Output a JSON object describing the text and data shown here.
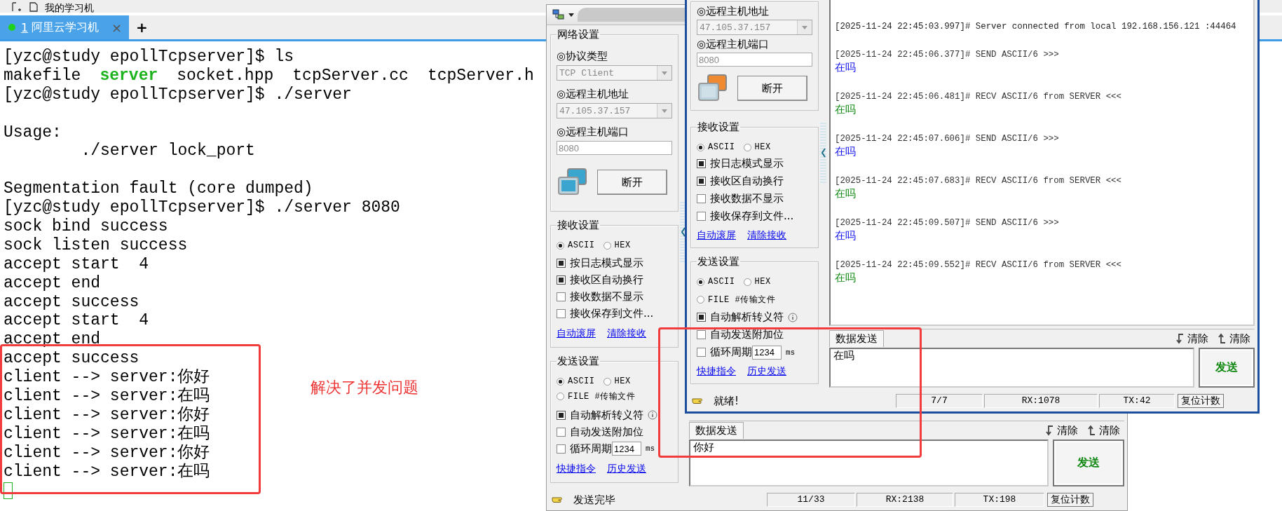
{
  "terminal": {
    "toolbar": {
      "label": "我的学习机"
    },
    "tabs": [
      {
        "number": "1",
        "label": "阿里云学习机",
        "close": "×",
        "selected": true,
        "connected": true
      }
    ],
    "new_tab": "+",
    "lines": [
      {
        "kind": "text",
        "text": "[yzc@study epollTcpserver]$ ls"
      },
      {
        "kind": "listing",
        "parts": [
          {
            "text": "makefile",
            "kind": "file"
          },
          {
            "text": "server",
            "kind": "executable"
          },
          {
            "text": "socket.hpp",
            "kind": "file"
          },
          {
            "text": "tcpServer.cc",
            "kind": "file"
          },
          {
            "text": "tcpServer.h",
            "kind": "file"
          }
        ]
      },
      {
        "kind": "text",
        "text": "[yzc@study epollTcpserver]$ ./server"
      },
      {
        "kind": "blank"
      },
      {
        "kind": "text",
        "text": "Usage:"
      },
      {
        "kind": "text",
        "text": "        ./server lock_port"
      },
      {
        "kind": "blank"
      },
      {
        "kind": "text",
        "text": "Segmentation fault (core dumped)"
      },
      {
        "kind": "text",
        "text": "[yzc@study epollTcpserver]$ ./server 8080"
      },
      {
        "kind": "text",
        "text": "sock bind success"
      },
      {
        "kind": "text",
        "text": "sock listen success"
      },
      {
        "kind": "text",
        "text": "accept start  4"
      },
      {
        "kind": "text",
        "text": "accept end"
      },
      {
        "kind": "text",
        "text": "accept success"
      },
      {
        "kind": "text",
        "text": "accept start  4"
      },
      {
        "kind": "text",
        "text": "accept end"
      },
      {
        "kind": "text",
        "text": "accept success"
      },
      {
        "kind": "text",
        "text": "client --> server:你好"
      },
      {
        "kind": "text",
        "text": "client --> server:在吗"
      },
      {
        "kind": "text",
        "text": "client --> server:你好"
      },
      {
        "kind": "text",
        "text": "client --> server:在吗"
      },
      {
        "kind": "text",
        "text": "client --> server:你好"
      },
      {
        "kind": "text",
        "text": "client --> server:在吗"
      }
    ],
    "cursor": true
  },
  "annotation": {
    "note": "解决了并发问题"
  },
  "windows": [
    {
      "title_bar": true,
      "focused": false,
      "network": {
        "title": "网络设置",
        "protocol_label": "◎协议类型",
        "protocol": "TCP Client",
        "host_label": "◎远程主机地址",
        "host": "47.105.37.157",
        "port_label": "◎远程主机端口",
        "port": "8080",
        "color": "#3aa6d0",
        "connect_button": "断开"
      },
      "receive": {
        "title": "接收设置",
        "modes": [
          {
            "label": "ASCII",
            "selected": true
          },
          {
            "label": "HEX",
            "selected": false
          }
        ],
        "options": [
          {
            "label": "按日志模式显示",
            "checked": true
          },
          {
            "label": "接收区自动换行",
            "checked": true
          },
          {
            "label": "接收数据不显示",
            "checked": false
          },
          {
            "label": "接收保存到文件...",
            "checked": false
          }
        ],
        "links": [
          "自动滚屏",
          "清除接收"
        ]
      },
      "send": {
        "title": "发送设置",
        "modes": [
          {
            "label": "ASCII",
            "selected": true
          },
          {
            "label": "HEX",
            "selected": false
          },
          {
            "label": "FILE #传输文件",
            "selected": false
          }
        ],
        "options": [
          {
            "kind": "check",
            "label": "自动解析转义符",
            "checked": true,
            "info": true
          },
          {
            "kind": "check",
            "label": "自动发送附加位",
            "checked": false
          },
          {
            "kind": "period",
            "label": "循环周期",
            "checked": false,
            "value": "1234",
            "unit": "ms"
          }
        ],
        "links": [
          "快捷指令",
          "历史发送"
        ]
      },
      "send_tab": "数据发送",
      "clear_buttons": [
        "清除",
        "清除"
      ],
      "message": "你好",
      "send_button": "发送",
      "status": "发送完毕",
      "counters": [
        "11/33",
        "RX:2138",
        "TX:198"
      ],
      "reset_button": "复位计数"
    },
    {
      "title_bar": false,
      "focused": true,
      "network": {
        "host_label": "◎远程主机地址",
        "host": "47.105.37.157",
        "port_label": "◎远程主机端口",
        "port": "8080",
        "color": "#f08a30",
        "connect_button": "断开"
      },
      "receive": {
        "title": "接收设置",
        "modes": [
          {
            "label": "ASCII",
            "selected": true
          },
          {
            "label": "HEX",
            "selected": false
          }
        ],
        "options": [
          {
            "label": "按日志模式显示",
            "checked": true
          },
          {
            "label": "接收区自动换行",
            "checked": true
          },
          {
            "label": "接收数据不显示",
            "checked": false
          },
          {
            "label": "接收保存到文件...",
            "checked": false
          }
        ],
        "links": [
          "自动滚屏",
          "清除接收"
        ]
      },
      "send": {
        "title": "发送设置",
        "modes": [
          {
            "label": "ASCII",
            "selected": true
          },
          {
            "label": "HEX",
            "selected": false
          },
          {
            "label": "FILE #传输文件",
            "selected": false
          }
        ],
        "options": [
          {
            "kind": "check",
            "label": "自动解析转义符",
            "checked": true,
            "info": true
          },
          {
            "kind": "check",
            "label": "自动发送附加位",
            "checked": false
          },
          {
            "kind": "period",
            "label": "循环周期",
            "checked": false,
            "value": "1234",
            "unit": "ms"
          }
        ],
        "links": [
          "快捷指令",
          "历史发送"
        ]
      },
      "log": [
        {
          "kind": "info",
          "header": "[2025-11-24 22:45:03.997]# Server connected from local 192.168.156.121 :44464"
        },
        {
          "kind": "send",
          "header": "[2025-11-24 22:45:06.377]# SEND ASCII/6 >>>",
          "body": "在吗"
        },
        {
          "kind": "recv",
          "header": "[2025-11-24 22:45:06.481]# RECV ASCII/6 from SERVER <<<",
          "body": "在吗"
        },
        {
          "kind": "send",
          "header": "[2025-11-24 22:45:07.606]# SEND ASCII/6 >>>",
          "body": "在吗"
        },
        {
          "kind": "recv",
          "header": "[2025-11-24 22:45:07.683]# RECV ASCII/6 from SERVER <<<",
          "body": "在吗"
        },
        {
          "kind": "send",
          "header": "[2025-11-24 22:45:09.507]# SEND ASCII/6 >>>",
          "body": "在吗"
        },
        {
          "kind": "recv",
          "header": "[2025-11-24 22:45:09.552]# RECV ASCII/6 from SERVER <<<",
          "body": "在吗"
        }
      ],
      "send_tab": "数据发送",
      "clear_buttons": [
        "清除",
        "清除"
      ],
      "message": "在吗",
      "send_button": "发送",
      "status": "就绪!",
      "counters": [
        "7/7",
        "RX:1078",
        "TX:42"
      ],
      "reset_button": "复位计数"
    }
  ]
}
